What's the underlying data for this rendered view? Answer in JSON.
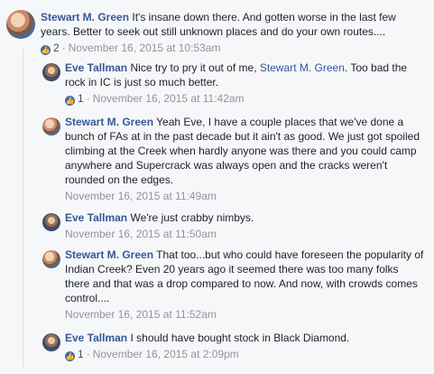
{
  "comments": [
    {
      "author": "Stewart M. Green",
      "mention": "",
      "text_before": "",
      "text": "It's insane down there. And gotten worse in the last few years. Better to seek out still unknown places and do your own routes....",
      "likes": "2",
      "timestamp": "November 16, 2015 at 10:53am"
    },
    {
      "author": "Eve Tallman",
      "text_before": "Nice try to pry it out of me, ",
      "mention": "Stewart M. Green",
      "text": ". Too bad the rock in IC is just so much better.",
      "likes": "1",
      "timestamp": "November 16, 2015 at 11:42am"
    },
    {
      "author": "Stewart M. Green",
      "text": "Yeah Eve, I have a couple places that we've done a bunch of FAs at in the past decade but it ain't as good. We just got spoiled climbing at the Creek when hardly anyone was there and you could camp anywhere and Supercrack was always open and the cracks weren't rounded on the edges.",
      "timestamp": "November 16, 2015 at 11:49am"
    },
    {
      "author": "Eve Tallman",
      "text": "We're just crabby nimbys.",
      "timestamp": "November 16, 2015 at 11:50am"
    },
    {
      "author": "Stewart M. Green",
      "text": "That too...but who could have foreseen the popularity of Indian Creek? Even 20 years ago it seemed there was too many folks there and that was a drop compared to now. And now, with crowds comes control....",
      "timestamp": "November 16, 2015 at 11:52am"
    },
    {
      "author": "Eve Tallman",
      "text": "I should have bought stock in Black Diamond.",
      "likes": "1",
      "timestamp": "November 16, 2015 at 2:09pm"
    }
  ],
  "icons": {
    "like_badge": "thumbs-up-icon",
    "like_glyph": "👍",
    "separator": "·"
  },
  "colors": {
    "author": "#365899",
    "meta": "#90949c",
    "like_badge": "#4267b2",
    "background": "#f6f7f9"
  }
}
